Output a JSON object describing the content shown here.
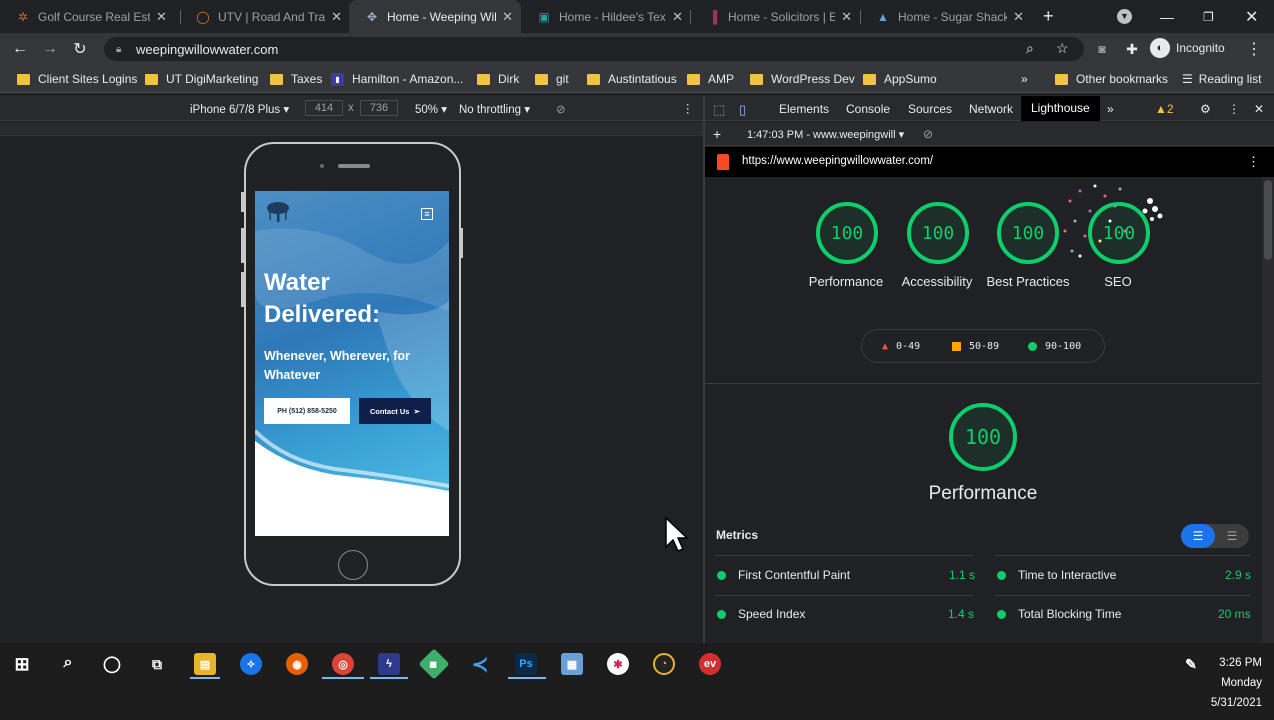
{
  "tabs": [
    {
      "title": "Golf Course Real Estate",
      "icon": "tree-favicon-icon",
      "color": "#c46a2b"
    },
    {
      "title": "UTV | Road And Track",
      "icon": "circle-favicon-icon",
      "color": "#e07a1f"
    },
    {
      "title": "Home - Weeping Willow",
      "icon": "willow-favicon-icon",
      "color": "#9fb4d8",
      "active": true
    },
    {
      "title": "Home - Hildee's Texas",
      "icon": "hildee-favicon-icon",
      "color": "#1aa3a3"
    },
    {
      "title": "Home - Solicitors | Est",
      "icon": "solicitors-favicon-icon",
      "color": "#a0325a"
    },
    {
      "title": "Home - Sugar Shack B",
      "icon": "sugar-shack-favicon-icon",
      "color": "#5aa9e6"
    }
  ],
  "address": {
    "url": "weepingwillowwater.com",
    "profile": "Incognito"
  },
  "bookmarks": [
    {
      "label": "Client Sites Logins"
    },
    {
      "label": "UT DigiMarketing"
    },
    {
      "label": "Taxes"
    },
    {
      "label": "Hamilton - Amazon..."
    },
    {
      "label": "Dirk"
    },
    {
      "label": "git"
    },
    {
      "label": "Austintatious"
    },
    {
      "label": "AMP"
    },
    {
      "label": "WordPress Dev"
    },
    {
      "label": "AppSumo"
    }
  ],
  "bookmarks_right": {
    "other": "Other bookmarks",
    "reading": "Reading list"
  },
  "device_toolbar": {
    "device": "iPhone 6/7/8 Plus",
    "width": "414",
    "height": "736",
    "zoom": "50%",
    "throttling": "No throttling"
  },
  "site": {
    "title": "Water Delivered:",
    "subtitle": "Whenever, Wherever, for Whatever",
    "phone_button": "PH (512) 858-5250",
    "contact_button": "Contact Us"
  },
  "devtools": {
    "tabs": [
      "Elements",
      "Console",
      "Sources",
      "Network",
      "Lighthouse"
    ],
    "active_tab": "Lighthouse",
    "warnings": "2",
    "report_time": "1:47:03 PM - www.weepingwill",
    "report_url": "https://www.weepingwillowwater.com/"
  },
  "lighthouse": {
    "scores": [
      {
        "label": "Performance",
        "value": "100"
      },
      {
        "label": "Accessibility",
        "value": "100"
      },
      {
        "label": "Best Practices",
        "value": "100"
      },
      {
        "label": "SEO",
        "value": "100"
      }
    ],
    "legend": {
      "fail": "0-49",
      "average": "50-89",
      "pass": "90-100"
    },
    "main_score": "100",
    "main_label": "Performance",
    "metrics_title": "Metrics",
    "metrics": [
      {
        "name": "First Contentful Paint",
        "value": "1.1 s"
      },
      {
        "name": "Time to Interactive",
        "value": "2.9 s"
      },
      {
        "name": "Speed Index",
        "value": "1.4 s"
      },
      {
        "name": "Total Blocking Time",
        "value": "20 ms"
      }
    ],
    "colors": {
      "pass": "#0cce6b",
      "average": "#ffa400",
      "fail": "#ff4e42"
    }
  },
  "clock": {
    "time": "3:26 PM",
    "day": "Monday",
    "date": "5/31/2021"
  }
}
